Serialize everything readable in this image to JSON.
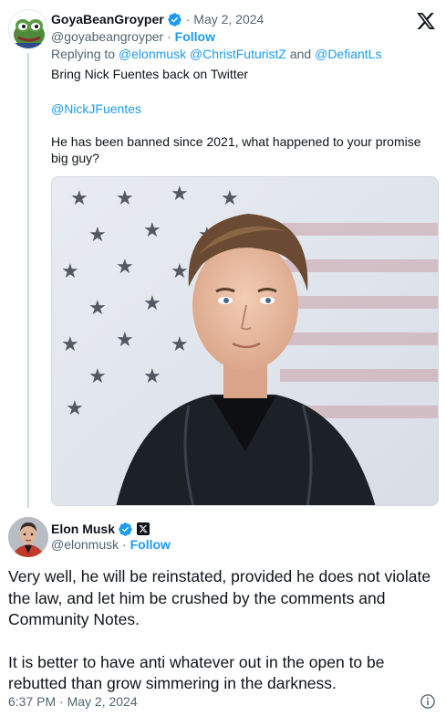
{
  "quoted_tweet": {
    "author_name": "GoyaBeanGroyper",
    "date": "May 2, 2024",
    "handle": "@goyabeangroyper",
    "follow_label": "Follow",
    "replying_to_label": "Replying to",
    "replying_to_handles": "@elonmusk @ChristFuturistZ",
    "replying_to_and": "and",
    "replying_to_last": "@DefiantLs",
    "text_line1": "Bring Nick Fuentes back on Twitter",
    "text_mention": "@NickJFuentes",
    "text_line3": "He has been banned since 2021, what happened to your promise big guy?",
    "avatar_icon": "pepe-frog-avatar",
    "image_alt": "photo-young-man-leather-jacket-flag-background"
  },
  "main_tweet": {
    "author_name": "Elon Musk",
    "handle": "@elonmusk",
    "follow_label": "Follow",
    "paragraph1": "Very well, he will be reinstated, provided he does not violate the law, and let him be crushed by the comments and Community Notes.",
    "paragraph2": "It is better to have anti whatever out in the open to be rebutted than grow simmering in the darkness.",
    "timestamp": "6:37 PM · May 2, 2024"
  },
  "colors": {
    "accent": "#1d9bf0",
    "text_primary": "#0f1419",
    "text_secondary": "#536471",
    "thread_line": "#cfd9de"
  },
  "icons": [
    "x-logo-icon",
    "verified-badge-icon",
    "x-affiliate-badge-icon",
    "info-icon"
  ]
}
